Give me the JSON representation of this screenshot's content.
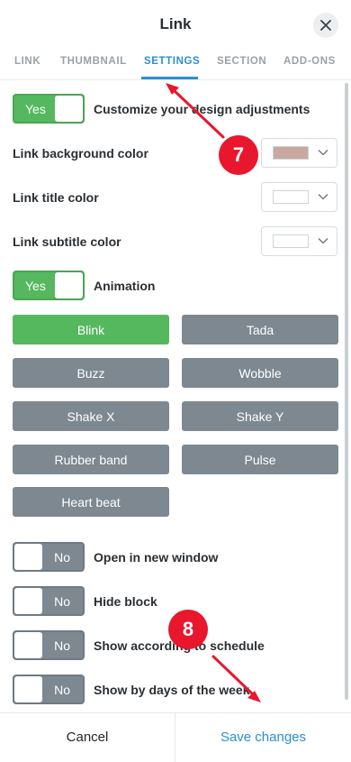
{
  "header": {
    "title": "Link"
  },
  "tabs": [
    {
      "label": "LINK"
    },
    {
      "label": "THUMBNAIL"
    },
    {
      "label": "SETTINGS"
    },
    {
      "label": "SECTION"
    },
    {
      "label": "ADD-ONS"
    }
  ],
  "active_tab": "SETTINGS",
  "settings": {
    "customize": {
      "toggle": "Yes",
      "label": "Customize your design adjustments"
    },
    "link_bg_color": {
      "label": "Link background color",
      "swatch": "#c9a8a0"
    },
    "link_title_color": {
      "label": "Link title color",
      "swatch": "#ffffff"
    },
    "link_subtitle_color": {
      "label": "Link subtitle color",
      "swatch": "#ffffff"
    },
    "animation": {
      "toggle": "Yes",
      "label": "Animation"
    },
    "animations": [
      "Blink",
      "Tada",
      "Buzz",
      "Wobble",
      "Shake X",
      "Shake Y",
      "Rubber band",
      "Pulse",
      "Heart beat"
    ],
    "selected_animation": "Blink",
    "open_new_window": {
      "toggle": "No",
      "label": "Open in new window"
    },
    "hide_block": {
      "toggle": "No",
      "label": "Hide block"
    },
    "schedule": {
      "toggle": "No",
      "label": "Show according to schedule"
    },
    "days_of_week": {
      "toggle": "No",
      "label": "Show by days of the week"
    }
  },
  "footer": {
    "cancel": "Cancel",
    "save": "Save changes"
  },
  "annotations": [
    {
      "number": "7"
    },
    {
      "number": "8"
    }
  ],
  "colors": {
    "accent": "#2b8fd6",
    "on": "#55b85f",
    "off": "#7d8891",
    "badge": "#e8172d"
  }
}
